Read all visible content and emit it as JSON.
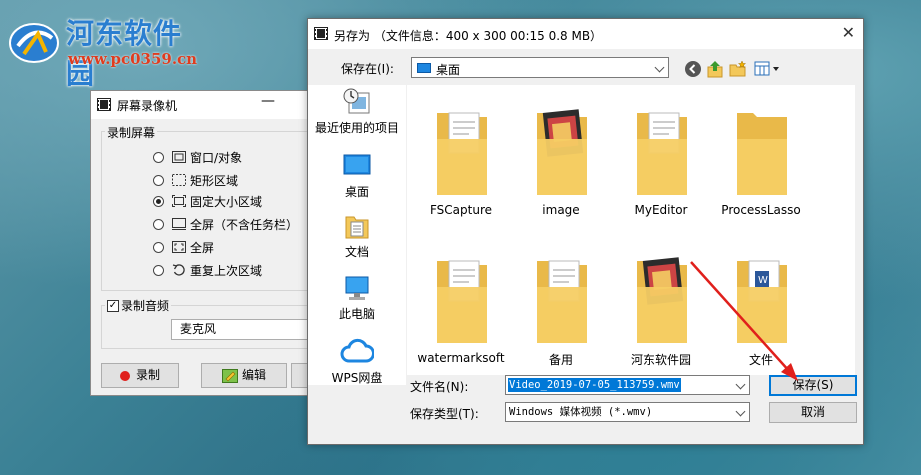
{
  "watermark": {
    "site_name": "河东软件园",
    "url": "www.pc0359.cn"
  },
  "recorder": {
    "title": "屏幕录像机",
    "minimize_glyph": "—",
    "record_screen_group": "录制屏幕",
    "options": [
      {
        "label": "窗口/对象",
        "selected": false,
        "icon": "window-object-icon"
      },
      {
        "label": "矩形区域",
        "selected": false,
        "icon": "rectangle-region-icon"
      },
      {
        "label": "固定大小区域",
        "selected": true,
        "icon": "fixed-size-region-icon"
      },
      {
        "label": "全屏（不含任务栏）",
        "selected": false,
        "icon": "fullscreen-no-taskbar-icon"
      },
      {
        "label": "全屏",
        "selected": false,
        "icon": "fullscreen-icon"
      },
      {
        "label": "重复上次区域",
        "selected": false,
        "icon": "repeat-last-region-icon"
      }
    ],
    "record_audio_label": "录制音频",
    "record_audio_checked": true,
    "audio_source": "麦克风",
    "record_button": "录制",
    "edit_button": "编辑"
  },
  "dialog": {
    "title": "另存为 （文件信息：400 x 300    00:15    0.8 MB）",
    "close_glyph": "✕",
    "save_in_label": "保存在(I):",
    "save_in_value": "桌面",
    "places": [
      {
        "label": "最近使用的项目",
        "icon": "recent-items-icon"
      },
      {
        "label": "桌面",
        "icon": "desktop-icon"
      },
      {
        "label": "文档",
        "icon": "documents-icon"
      },
      {
        "label": "此电脑",
        "icon": "this-pc-icon"
      },
      {
        "label": "WPS网盘",
        "icon": "wps-cloud-icon"
      }
    ],
    "folders": [
      {
        "name": "FSCapture",
        "overlay": "document"
      },
      {
        "name": "image",
        "overlay": "photo"
      },
      {
        "name": "MyEditor",
        "overlay": "document"
      },
      {
        "name": "ProcessLasso",
        "overlay": "plain"
      },
      {
        "name": "watermarksoft",
        "overlay": "document"
      },
      {
        "name": "备用",
        "overlay": "document"
      },
      {
        "name": "河东软件园",
        "overlay": "photo"
      },
      {
        "name": "文件",
        "overlay": "word"
      }
    ],
    "filename_label": "文件名(N):",
    "filename_value": "Video_2019-07-05_113759.wmv",
    "filetype_label": "保存类型(T):",
    "filetype_value": "Windows 媒体视频 (*.wmv)",
    "save_button": "保存(S)",
    "cancel_button": "取消",
    "accent_color": "#0078d7",
    "annotation_color": "#e0201c"
  }
}
